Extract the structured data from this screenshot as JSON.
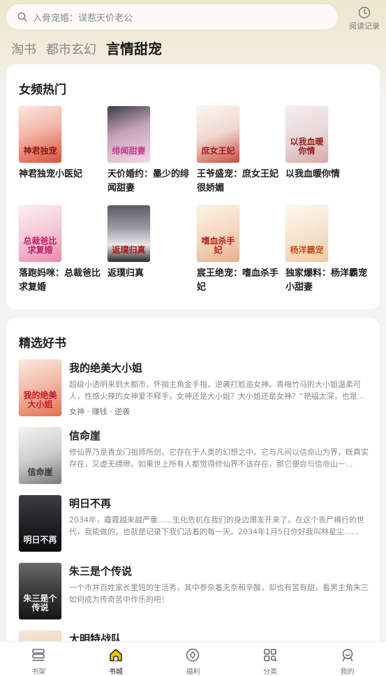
{
  "search": {
    "placeholder": "入骨宠婚：误惹天价老公"
  },
  "history": {
    "label": "阅读记录"
  },
  "tabs": [
    {
      "label": "淘书"
    },
    {
      "label": "都市玄幻"
    },
    {
      "label": "言情甜宠",
      "active": true
    }
  ],
  "hot": {
    "title": "女频热门",
    "books": [
      {
        "name": "神君独宠小医妃",
        "cover_text": "神君独宠",
        "color": "#c8423a"
      },
      {
        "name": "天价婚约：墨少的绯闻甜妻",
        "cover_text": "绯闻甜妻",
        "color": "#c87aa8"
      },
      {
        "name": "王爷盛宠：庶女王妃很娇媚",
        "cover_text": "庶女王妃",
        "color": "#b8343a"
      },
      {
        "name": "以我血暖你情",
        "cover_text": "以我血暖你情",
        "color": "#b02a2a"
      },
      {
        "name": "落跑妈咪：总裁爸比求复婚",
        "cover_text": "总裁爸比求复婚",
        "color": "#c8336e"
      },
      {
        "name": "返璞归真",
        "cover_text": "返璞归真",
        "color": "#333333"
      },
      {
        "name": "宸王绝宠：嗜血杀手妃",
        "cover_text": "嗜血杀手妃",
        "color": "#c0302e"
      },
      {
        "name": "独家爆料：杨洋霸宠小甜妻",
        "cover_text": "杨洋霸宠",
        "color": "#c96a2a"
      }
    ]
  },
  "picks": {
    "title": "精选好书",
    "items": [
      {
        "title": "我的绝美大小姐",
        "desc": "超级小透明来到大都市，怀揣主角金手指，逆袭打脸追女神。青梅竹马的大小姐温柔可人，性感火辣的女神爱不释手，女神还是大小姐？大小姐还是女神？“艳福太深，也是...",
        "tags": "女神 · 赚钱 · 逆袭",
        "cover_text": "我的绝美大小姐"
      },
      {
        "title": "信命崖",
        "desc": "修仙界乃是青龙门祖师所创，它存在于人类的幻想之中。它与凡间以信命山为界，既真实存在，又虚无缥缈。如果世上所有人都觉得修仙界不该存在，那它便会与信命山一...",
        "tags": "",
        "cover_text": "信命崖"
      },
      {
        "title": "明日不再",
        "desc": "2034年，霾霧越来越严重......生化危机在我们的身边爆发开来了。在这个丧尸横行的世代，我能做的，也就是记录下我们活着的每一天。2034年1月5日你好我叫林星尘......",
        "tags": "",
        "cover_text": "明日不再"
      },
      {
        "title": "朱三是个传说",
        "desc": "一个市井百姓家长里短的生活秀，其中参杂着无奈和辛酸，却也有苦有甜，看男主角朱三如何成为传奇苦中作乐的吧！",
        "tags": "",
        "cover_text": "朱三是个传说"
      },
      {
        "title": "大明特战队",
        "desc": "",
        "tags": "",
        "cover_text": ""
      }
    ]
  },
  "nav": [
    {
      "label": "书架",
      "icon": "bookshelf-icon"
    },
    {
      "label": "书城",
      "icon": "bookstore-icon",
      "active": true
    },
    {
      "label": "福利",
      "icon": "welfare-icon"
    },
    {
      "label": "分类",
      "icon": "category-icon"
    },
    {
      "label": "我的",
      "icon": "profile-icon"
    }
  ],
  "colors": {
    "accent": "#f5c400",
    "background": "#f3f3f3",
    "card": "#ffffff"
  }
}
